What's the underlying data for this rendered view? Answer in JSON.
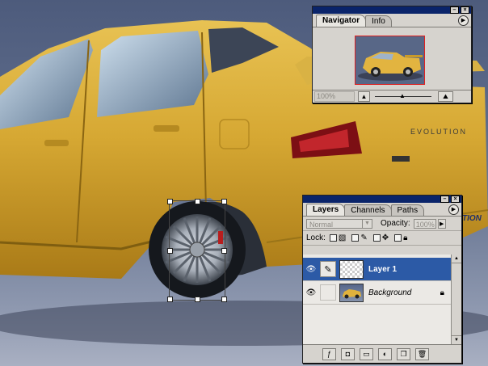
{
  "navigator": {
    "tabs": [
      {
        "label": "Navigator",
        "active": true
      },
      {
        "label": "Info",
        "active": false
      }
    ],
    "zoom": "100%",
    "menu_icon": "palette-menu-arrow-icon",
    "colors": {
      "view_box": "#e02020"
    }
  },
  "layers": {
    "tabs": [
      {
        "label": "Layers",
        "active": true
      },
      {
        "label": "Channels",
        "active": false
      },
      {
        "label": "Paths",
        "active": false
      }
    ],
    "blend_mode": "Normal",
    "opacity_label": "Opacity:",
    "opacity_value": "100%",
    "lock_label": "Lock:",
    "items": [
      {
        "name": "Layer 1",
        "selected": true,
        "visible": true
      },
      {
        "name": "Background",
        "selected": false,
        "visible": true,
        "locked": true
      }
    ],
    "bottom_icons": [
      "layer-style-icon",
      "layer-mask-icon",
      "new-set-icon",
      "adjustment-layer-icon",
      "new-layer-icon",
      "trash-icon"
    ],
    "colors": {
      "selection": "#2c5aa6"
    }
  },
  "canvas": {
    "badge_text": "EVOLUTION",
    "tail_text": "TION"
  }
}
